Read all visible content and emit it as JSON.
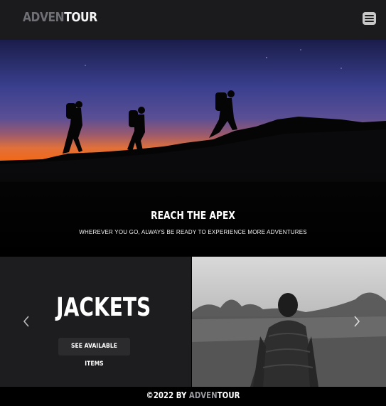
{
  "header": {
    "logo_part1": "ADVEN",
    "logo_part2": "TOUR",
    "menu_icon": "hamburger-icon"
  },
  "hero": {
    "title": "REACH THE APEX",
    "subtitle": "WHEREVER YOU GO, ALWAYS BE READY TO EXPERIENCE MORE ADVENTURES"
  },
  "carousel": {
    "title": "JACKETS",
    "button_label": "SEE AVAILABLE ITEMS",
    "prev_icon": "chevron-left-icon",
    "next_icon": "chevron-right-icon"
  },
  "footer": {
    "prefix": "©2022 BY ",
    "brand_part1": "ADVEN",
    "brand_part2": "TOUR"
  },
  "colors": {
    "header_bg": "#1b1b1d",
    "panel_bg": "#1d1d1f",
    "button_bg": "#2b2b2e",
    "logo_muted": "#6f7075"
  }
}
